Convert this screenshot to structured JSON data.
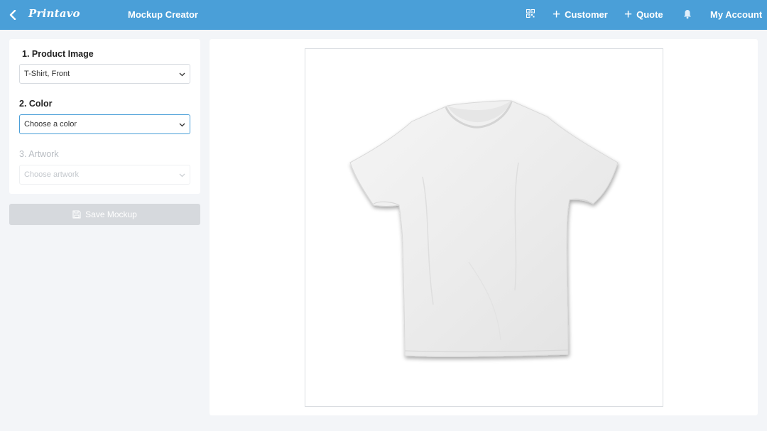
{
  "header": {
    "logo": "Printavo",
    "title": "Mockup Creator",
    "nav": {
      "customer_label": "Customer",
      "quote_label": "Quote",
      "account_label": "My Account"
    }
  },
  "form": {
    "product_image": {
      "label": "1. Product Image",
      "value": "T-Shirt, Front"
    },
    "color": {
      "label": "2. Color",
      "value": "Choose a color"
    },
    "artwork": {
      "label": "3. Artwork",
      "value": "Choose artwork"
    },
    "save_label": "Save Mockup"
  },
  "colors": {
    "header_bg": "#4a9fd8",
    "page_bg": "#f3f5f8",
    "focus_border": "#4a9fd8",
    "disabled_button": "#d6d9dd"
  },
  "icons": [
    "back-arrow-icon",
    "qr-code-icon",
    "plus-icon",
    "bell-icon",
    "chevron-down-icon",
    "floppy-disk-icon"
  ]
}
